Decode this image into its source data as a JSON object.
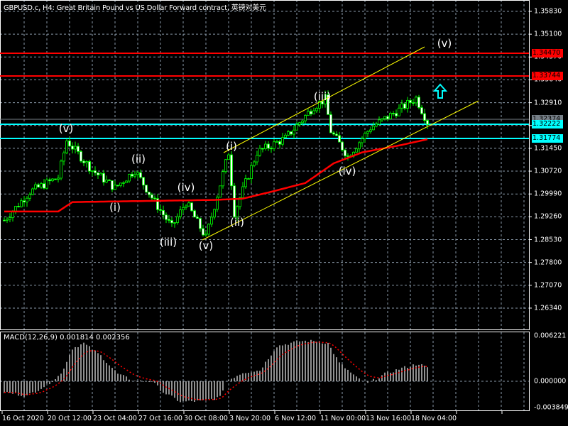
{
  "header": {
    "title": "GBPUSD.c, H4:  Great Britain Pound vs US Dollar Forward contract, 英镑对美元"
  },
  "macd": {
    "title": "MACD(12,26,9) 0.001814 0.002356",
    "axis": [
      "0.006221",
      "0.000000",
      "-0.003849"
    ]
  },
  "colors": {
    "bull": "#00ff00",
    "bear_body": "#ffffff",
    "ma": "#ff0000",
    "resistance": "#ff0000",
    "support": "#00ffff",
    "channel": "#ffff00",
    "grid": "#8a9aaa",
    "macd_hist": "#c0c0c0",
    "macd_signal": "#ff0000",
    "current": "#778088"
  },
  "price_axis": [
    "1.35830",
    "1.35100",
    "1.34370",
    "1.33640",
    "1.32910",
    "1.32180",
    "1.31450",
    "1.30720",
    "1.29990",
    "1.29260",
    "1.28530",
    "1.27800",
    "1.27070",
    "1.26340"
  ],
  "price_tags": {
    "r1": "1.34470",
    "r2": "1.33744",
    "current": "1.32374",
    "s1": "1.32222",
    "s2": "1.31774"
  },
  "time_axis": [
    "16 Oct 2020",
    "20 Oct 12:00",
    "23 Oct 04:00",
    "27 Oct 16:00",
    "30 Oct 08:00",
    "3 Nov 20:00",
    "6 Nov 12:00",
    "11 Nov 00:00",
    "13 Nov 16:00",
    "18 Nov 04:00"
  ],
  "wave_labels": {
    "v1": "(v)",
    "i1": "(i)",
    "ii1": "(ii)",
    "iii1": "(iii)",
    "iv1": "(iv)",
    "v2": "(v)",
    "i2": "(i)",
    "ii2": "(ii)",
    "iii2": "(iii)",
    "iv2": "(iv)",
    "v3": "(v)"
  },
  "chart_data": {
    "type": "candlestick",
    "symbol": "GBPUSD.c",
    "timeframe": "H4",
    "price_path": [
      [
        0,
        1.2915
      ],
      [
        9,
        1.3006
      ],
      [
        19,
        1.3052
      ],
      [
        22,
        1.317
      ],
      [
        31,
        1.3075
      ],
      [
        39,
        1.3018
      ],
      [
        46,
        1.3075
      ],
      [
        53,
        1.2973
      ],
      [
        59,
        1.2893
      ],
      [
        64,
        1.2973
      ],
      [
        71,
        1.2859
      ],
      [
        79,
        1.3132
      ],
      [
        81,
        1.2939
      ],
      [
        89,
        1.3132
      ],
      [
        99,
        1.3177
      ],
      [
        109,
        1.3279
      ],
      [
        113,
        1.3302
      ],
      [
        115,
        1.32
      ],
      [
        121,
        1.312
      ],
      [
        129,
        1.3211
      ],
      [
        139,
        1.3268
      ],
      [
        145,
        1.3306
      ],
      [
        149,
        1.3229
      ]
    ],
    "moving_average": [
      [
        0,
        1.2943
      ],
      [
        19,
        1.2943
      ],
      [
        24,
        1.2973
      ],
      [
        74,
        1.298
      ],
      [
        84,
        1.2984
      ],
      [
        94,
        1.3006
      ],
      [
        106,
        1.3034
      ],
      [
        116,
        1.3097
      ],
      [
        126,
        1.3132
      ],
      [
        139,
        1.3154
      ],
      [
        149,
        1.3174
      ]
    ],
    "macd_hist": [
      [
        0,
        -0.0015
      ],
      [
        8,
        -0.002
      ],
      [
        15,
        -0.0005
      ],
      [
        20,
        0.001
      ],
      [
        24,
        0.0045
      ],
      [
        28,
        0.0052
      ],
      [
        34,
        0.0035
      ],
      [
        40,
        0.001
      ],
      [
        46,
        0
      ],
      [
        52,
        0
      ],
      [
        56,
        -0.0015
      ],
      [
        62,
        -0.0028
      ],
      [
        70,
        -0.0027
      ],
      [
        76,
        -0.0022
      ],
      [
        78,
        0
      ],
      [
        84,
        0.0012
      ],
      [
        90,
        0.0015
      ],
      [
        96,
        0.0048
      ],
      [
        104,
        0.0055
      ],
      [
        110,
        0.0055
      ],
      [
        114,
        0.0052
      ],
      [
        118,
        0.0025
      ],
      [
        124,
        0.0005
      ],
      [
        128,
        -0.0003
      ],
      [
        134,
        0.001
      ],
      [
        140,
        0.0018
      ],
      [
        146,
        0.0024
      ],
      [
        149,
        0.0018
      ]
    ],
    "price_range": [
      1.256,
      1.362
    ],
    "macd_range": [
      -0.003849,
      0.006221
    ]
  }
}
